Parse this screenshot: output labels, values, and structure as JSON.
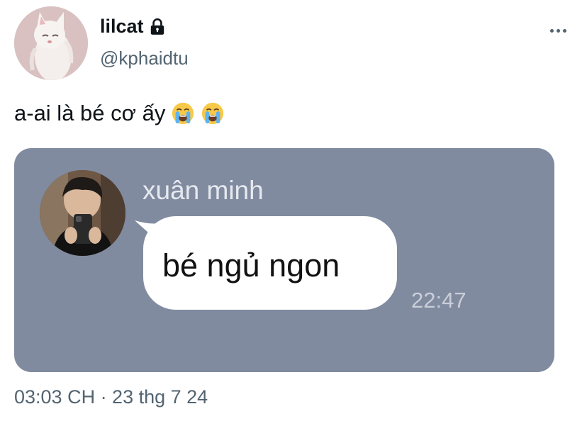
{
  "author": {
    "display_name": "lilcat",
    "handle": "@kphaidtu",
    "avatar_icon": "cartoon-cat-avatar",
    "protected_icon": "lock-icon"
  },
  "menu": {
    "icon": "more-options-icon"
  },
  "tweet": {
    "text": "a-ai là bé cơ ấy",
    "emojis": [
      "loudly-crying-face-emoji",
      "loudly-crying-face-emoji"
    ]
  },
  "media": {
    "background_color": "#818ba0",
    "chat": {
      "sender_name": "xuân minh",
      "message": "bé ngủ ngon",
      "time": "22:47"
    }
  },
  "meta": {
    "timestamp": "03:03 CH · 23 thg 7 24"
  }
}
